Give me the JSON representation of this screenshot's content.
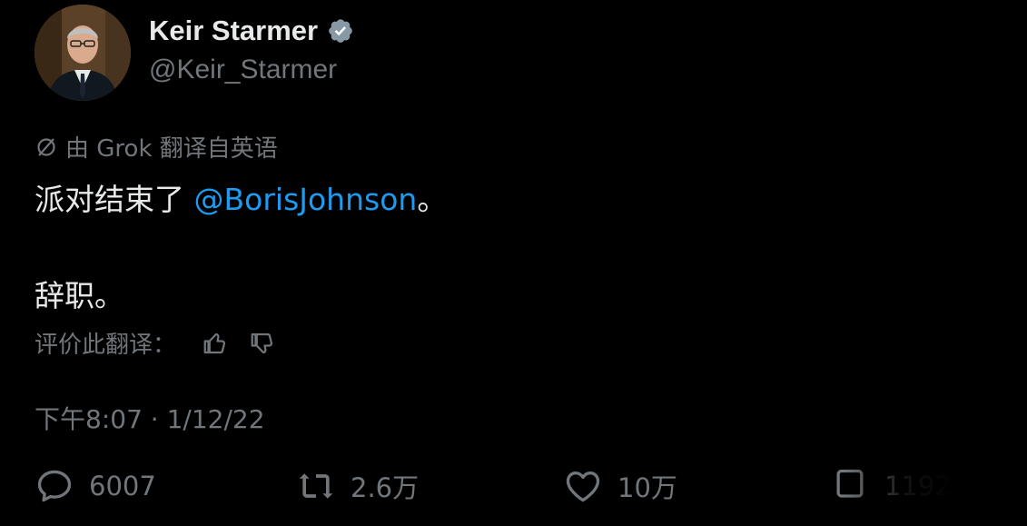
{
  "author": {
    "display_name": "Keir Starmer",
    "handle": "@Keir_Starmer",
    "avatar_icon": "avatar",
    "verified_icon": "verified-badge-icon",
    "verified_color": "#1d9bf0"
  },
  "translation": {
    "note": "由 Grok 翻译自英语",
    "rate_label": "评价此翻译："
  },
  "tweet": {
    "line1_prefix": "派对结束了 ",
    "mention": "@BorisJohnson",
    "line1_suffix": "。",
    "line2": "辞职。",
    "mention_color": "#1d9bf0"
  },
  "timestamp": "下午8:07 · 1/12/22",
  "actions": {
    "replies": "6007",
    "retweets": "2.6万",
    "likes": "10万",
    "views": "1192"
  },
  "colors": {
    "background": "#000000",
    "text_primary": "#e7e9ea",
    "text_secondary": "#71767b"
  }
}
